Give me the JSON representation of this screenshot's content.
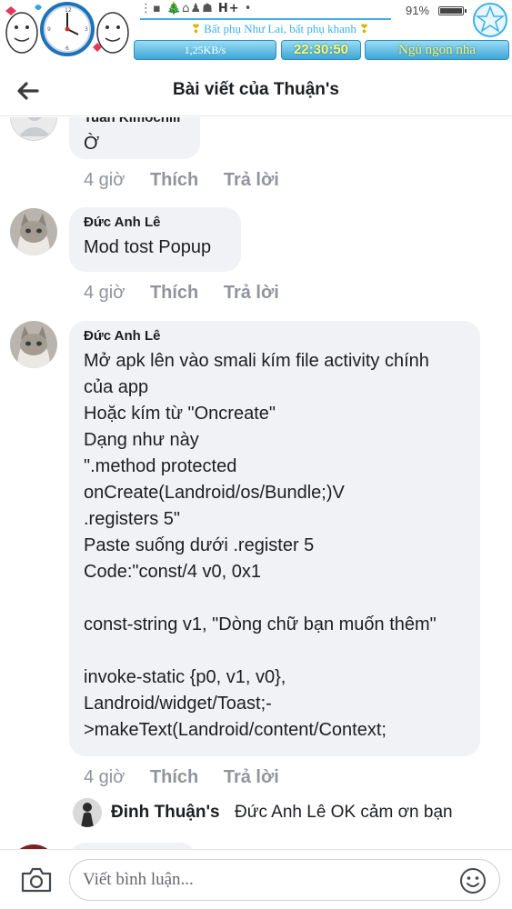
{
  "status_bar": {
    "network": "H+",
    "battery_pct": "91%",
    "battery_level": 0.91,
    "marquee_icon_left": "❣",
    "marquee_text": "Bất phụ Như Lai, bất phụ khanh",
    "marquee_icon_right": "❣",
    "speed": "1,25KB/s",
    "time": "22:30:50",
    "message": "Ngủ ngon nha",
    "accent": "#3db0e8"
  },
  "header": {
    "title": "Bài viết của Thuận's",
    "back_icon": "arrow-left-icon"
  },
  "comments": [
    {
      "author": "Tuấn Kimochiii",
      "text": "Ờ",
      "time": "4 giờ",
      "like": "Thích",
      "reply": "Trả lời"
    },
    {
      "author": "Đức Anh Lê",
      "text": "Mod tost Popup",
      "time": "4 giờ",
      "like": "Thích",
      "reply": "Trả lời"
    },
    {
      "author": "Đức Anh Lê",
      "text": "Mở apk lên vào smali kím file activity chính\ncủa app\nHoặc kím từ \"Oncreate\"\nDạng như này\n\".method protected\nonCreate(Landroid/os/Bundle;)V\n.registers 5\"\nPaste suống dưới .register 5\nCode:\"const/4 v0, 0x1\n\nconst-string v1, \"Dòng chữ bạn muốn thêm\"\n\ninvoke-static {p0, v1, v0},\nLandroid/widget/Toast;-\n>makeText(Landroid/content/Context;",
      "time": "4 giờ",
      "like": "Thích",
      "reply": "Trả lời"
    }
  ],
  "reply_preview": {
    "author": "Đinh Thuận's",
    "text": "Đức Anh Lê OK cảm ơn bạn"
  },
  "composer": {
    "placeholder": "Viết bình luận...",
    "camera_icon": "camera-icon",
    "emoji_icon": "smiley-icon"
  }
}
